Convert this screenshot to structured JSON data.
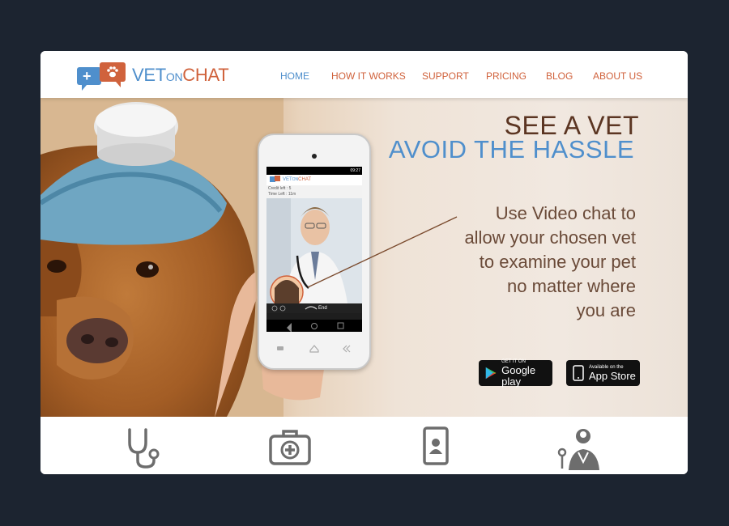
{
  "logo": {
    "vet": "VET",
    "on": "ON",
    "chat": "CHAT"
  },
  "nav": [
    {
      "label": "HOME",
      "active": true
    },
    {
      "label": "HOW IT WORKS"
    },
    {
      "label": "SUPPORT"
    },
    {
      "label": "PRICING"
    },
    {
      "label": "BLOG"
    },
    {
      "label": "ABOUT US"
    }
  ],
  "hero": {
    "title_line1": "SEE A VET",
    "title_line2": "AVOID THE HASSLE",
    "copy": [
      "Use Video chat to",
      "allow your chosen vet",
      "to examine your pet",
      "no matter where",
      "you are"
    ]
  },
  "phone": {
    "time": "09:27",
    "credit_left": "Credit left : 5",
    "time_left": "Time Left : 11m",
    "end_label": "End",
    "app_logo_vet": "VET",
    "app_logo_on": "ON",
    "app_logo_chat": "CHAT"
  },
  "stores": {
    "google": {
      "small": "GET IT ON",
      "big": "Google play"
    },
    "apple": {
      "small": "Available on the",
      "big": "App Store"
    }
  },
  "features": [
    {
      "icon": "stethoscope-icon"
    },
    {
      "icon": "medical-kit-icon"
    },
    {
      "icon": "tablet-user-icon"
    },
    {
      "icon": "doctor-icon"
    }
  ],
  "colors": {
    "blue": "#4f8fcc",
    "orange": "#d0623c",
    "brown": "#5b3522",
    "background": "#1c2430"
  }
}
